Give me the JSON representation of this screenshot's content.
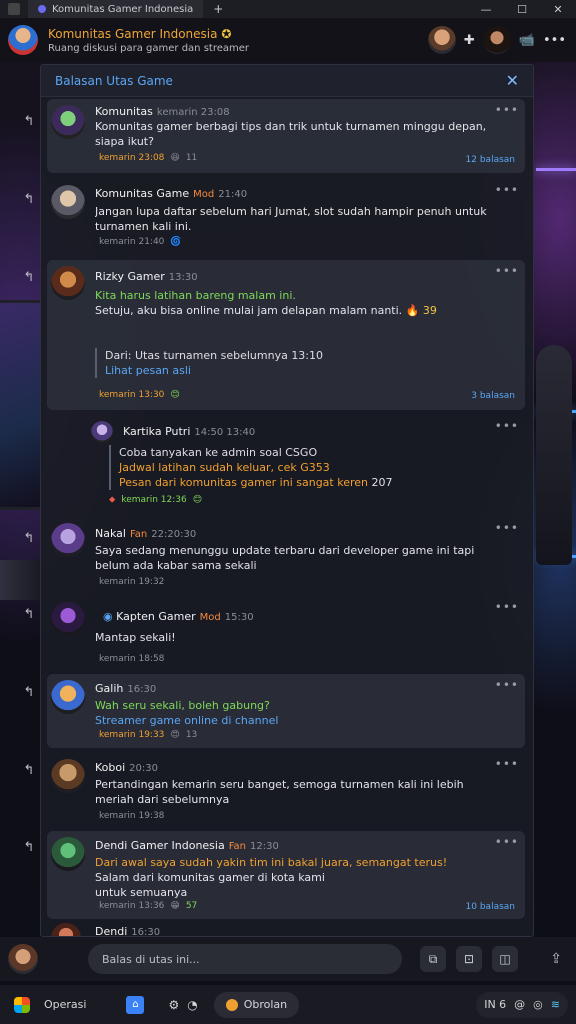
{
  "titlebar": {
    "tab_label": "Komunitas Gamer Indonesia",
    "new_tab": "+",
    "min": "—",
    "max": "☐",
    "close": "✕"
  },
  "header": {
    "title": "Komunitas Gamer Indonesia",
    "title_emoji": "✪",
    "subtitle": "Ruang diskusi para gamer dan streamer",
    "icons": {
      "add": "✚",
      "video": "📹",
      "more": "•••"
    }
  },
  "thread": {
    "title": "Balasan Utas Game",
    "close": "✕"
  },
  "messages": [
    {
      "name": "Komunitas",
      "time": "kemarin 23:08",
      "lines": [
        "Komunitas gamer berbagi tips dan trik untuk turnamen minggu depan,",
        "siapa ikut?"
      ],
      "meta": {
        "time": "kemarin 23:08",
        "reaction_emoji": "😆",
        "reaction_count": "11"
      },
      "stat": "12 balasan"
    },
    {
      "name": "Komunitas Game",
      "tag": "Mod",
      "time": "21:40",
      "lines": [
        "Jangan lupa daftar sebelum hari Jumat, slot sudah hampir penuh untuk",
        "turnamen kali ini."
      ],
      "meta": {
        "time": "kemarin 21:40",
        "reaction_emoji": "🌀",
        "reaction_count": ""
      }
    },
    {
      "name": "Rizky Gamer",
      "time": "13:30",
      "lines_orange": "Kita harus latihan bareng malam ini.",
      "lines": [
        "Setuju, aku bisa online mulai jam delapan malam nanti."
      ],
      "inline_emoji": "🔥",
      "inline_count": "39",
      "quote_title": "Dari: Utas turnamen sebelumnya 13:10",
      "quote_link": "Lihat pesan asli",
      "meta": {
        "time": "kemarin 13:30",
        "reaction_emoji": "😊",
        "reaction_count": ""
      },
      "stat": "3 balasan"
    },
    {
      "name": "Kartika Putri",
      "time": "14:50 13:40",
      "quote": [
        "Coba tanyakan ke admin soal CSGO",
        "Jadwal latihan sudah keluar, cek G353",
        "Pesan dari komunitas gamer ini sangat keren"
      ],
      "quote_suffix": "207",
      "meta": {
        "time": "kemarin 12:36",
        "reaction_emoji": "😊",
        "reaction_count": ""
      }
    },
    {
      "name": "Nakal",
      "tag": "Fan",
      "time": "22:20:30",
      "lines": [
        "Saya sedang menunggu update terbaru dari developer game ini tapi",
        "belum ada kabar sama sekali"
      ],
      "meta": {
        "time": "kemarin 19:32",
        "reaction_emoji": "",
        "reaction_count": ""
      }
    },
    {
      "name": "Kapten Gamer",
      "tag": "Mod",
      "time": "15:30",
      "lines": [
        "Mantap sekali!"
      ],
      "meta": {
        "time": "kemarin 18:58",
        "reaction_emoji": "",
        "reaction_count": ""
      }
    },
    {
      "name": "Galih",
      "tag": "",
      "time": "16:30",
      "lines_green": "Wah seru sekali, boleh gabung?",
      "lines_blue": "Streamer game online di channel",
      "meta": {
        "time": "kemarin 19:33",
        "reaction_emoji": "😍",
        "reaction_count": "13"
      }
    },
    {
      "name": "Koboi",
      "time": "20:30",
      "lines": [
        "Pertandingan kemarin seru banget, semoga turnamen kali ini lebih",
        "meriah dari sebelumnya"
      ],
      "meta": {
        "time": "kemarin 19:38",
        "reaction_emoji": "",
        "reaction_count": ""
      }
    },
    {
      "name": "Dendi Gamer Indonesia",
      "tag": "Fan",
      "time": "12:30",
      "lines_orange": "Dari awal saya sudah yakin tim ini bakal juara, semangat terus!",
      "lines": [
        "Salam dari komunitas gamer di kota kami",
        "untuk semuanya"
      ],
      "meta": {
        "time": "kemarin 13:36",
        "reaction_emoji": "😁",
        "reaction_count": "57"
      },
      "stat": "10 balasan"
    },
    {
      "name": "Dendi",
      "time": "16:30",
      "lines": []
    }
  ],
  "composer": {
    "placeholder": "Balas di utas ini..."
  },
  "taskbar": {
    "label": "Operasi",
    "pill_label": "Obrolan",
    "tray_text": "IN 6"
  }
}
